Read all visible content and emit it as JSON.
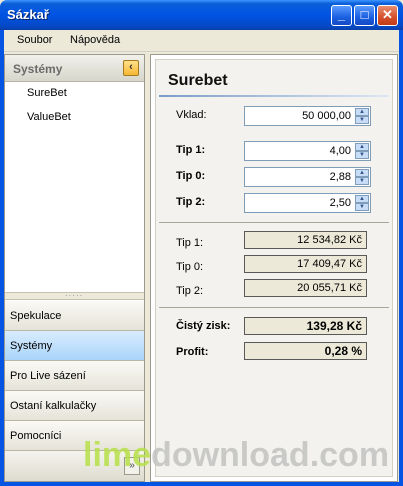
{
  "window": {
    "title": "Sázkař",
    "minimize_glyph": "_",
    "maximize_glyph": "□",
    "close_glyph": "✕"
  },
  "menu": [
    "Soubor",
    "Nápověda"
  ],
  "nav": {
    "header": "Systémy",
    "collapse_glyph": "‹",
    "list": [
      "SureBet",
      "ValueBet"
    ],
    "splitter_glyph": "·····",
    "buttons": [
      "Spekulace",
      "Systémy",
      "Pro Live sázení",
      "Ostaní kalkulačky",
      "Pomocníci"
    ],
    "active": "Systémy",
    "expand_glyph": "»"
  },
  "panel": {
    "title": "Surebet",
    "vklad_label": "Vklad:",
    "vklad_value": "50 000,00",
    "tips": [
      {
        "label": "Tip 1:",
        "value": "4,00"
      },
      {
        "label": "Tip 0:",
        "value": "2,88"
      },
      {
        "label": "Tip 2:",
        "value": "2,50"
      }
    ],
    "results": [
      {
        "label": "Tip 1:",
        "value": "12 534,82 Kč"
      },
      {
        "label": "Tip 0:",
        "value": "17 409,47 Kč"
      },
      {
        "label": "Tip 2:",
        "value": "20 055,71 Kč"
      }
    ],
    "net_profit_label": "Čistý zisk:",
    "net_profit_value": "139,28 Kč",
    "profit_label": "Profit:",
    "profit_value": "0,28 %"
  },
  "watermark": {
    "part1": "lime",
    "part2": "download.com"
  }
}
